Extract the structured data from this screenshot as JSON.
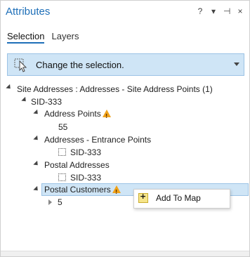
{
  "pane": {
    "title": "Attributes",
    "tools": {
      "help": "?",
      "menu": "▾",
      "pin": "⊣",
      "close": "×"
    }
  },
  "tabs": [
    {
      "label": "Selection",
      "selected": true
    },
    {
      "label": "Layers",
      "selected": false
    }
  ],
  "action_bar": {
    "label": "Change the selection."
  },
  "tree": {
    "root": "Site Addresses : Addresses - Site Address Points (1)",
    "feature": "SID-333",
    "groups": [
      {
        "label": "Address Points",
        "warning": true,
        "child": "55",
        "child_checkbox": false
      },
      {
        "label": "Addresses - Entrance Points",
        "warning": false,
        "child": "SID-333",
        "child_checkbox": true
      },
      {
        "label": "Postal Addresses",
        "warning": false,
        "child": "SID-333",
        "child_checkbox": true
      },
      {
        "label": "Postal Customers",
        "warning": true,
        "child": "5",
        "child_checkbox": false,
        "selected": true
      }
    ]
  },
  "context_menu": {
    "items": [
      {
        "label": "Add To Map",
        "icon": "add-to-map-icon"
      }
    ]
  },
  "colors": {
    "accent": "#1e6fb8",
    "selection": "#cfe5f6",
    "warning": "#f0a21a"
  }
}
